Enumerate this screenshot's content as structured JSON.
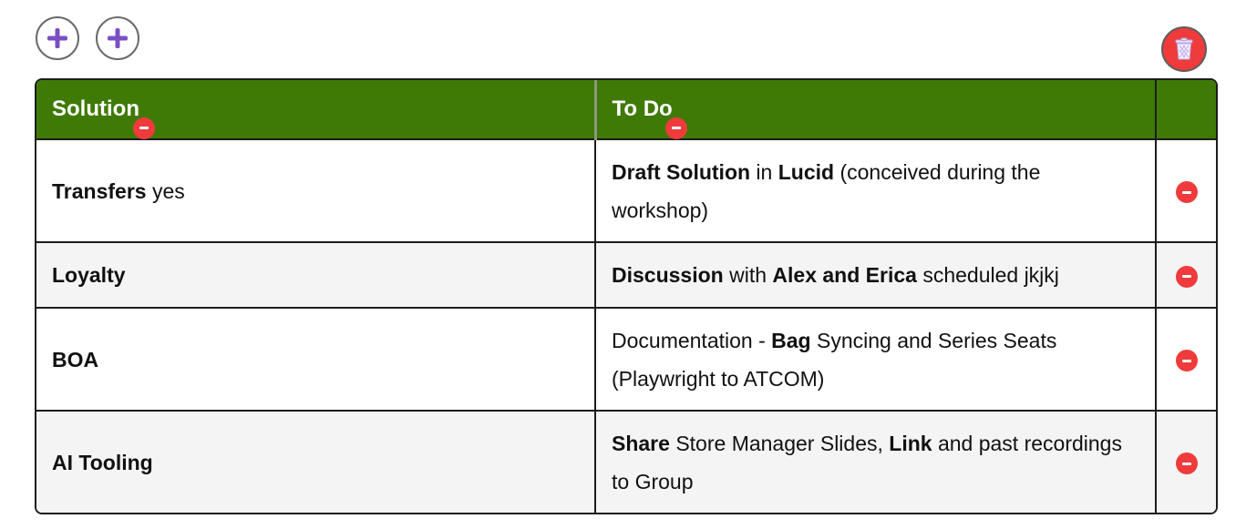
{
  "toolbar": {
    "add_buttons": [
      "add-row",
      "add-column"
    ],
    "delete_icon": "trash-icon"
  },
  "table": {
    "columns": [
      {
        "label": "Solution"
      },
      {
        "label": "To Do"
      }
    ],
    "rows": [
      {
        "solution": [
          {
            "t": "Transfers",
            "b": true
          },
          {
            "t": " yes",
            "b": false
          }
        ],
        "todo": [
          {
            "t": "Draft Solution",
            "b": true
          },
          {
            "t": " in ",
            "b": false
          },
          {
            "t": "Lucid",
            "b": true
          },
          {
            "t": " (conceived during the workshop)",
            "b": false
          }
        ]
      },
      {
        "solution": [
          {
            "t": "Loyalty",
            "b": true
          }
        ],
        "todo": [
          {
            "t": "Discussion",
            "b": true
          },
          {
            "t": " with ",
            "b": false
          },
          {
            "t": "Alex and Erica",
            "b": true
          },
          {
            "t": " scheduled jkjkj",
            "b": false
          }
        ]
      },
      {
        "solution": [
          {
            "t": "BOA",
            "b": true
          }
        ],
        "todo": [
          {
            "t": "Documentation - ",
            "b": false
          },
          {
            "t": "Bag",
            "b": true
          },
          {
            "t": " Syncing and Series Seats (Playwright to ATCOM)",
            "b": false
          }
        ]
      },
      {
        "solution": [
          {
            "t": "AI Tooling",
            "b": true
          }
        ],
        "todo": [
          {
            "t": "Share",
            "b": true
          },
          {
            "t": " Store Manager Slides, ",
            "b": false
          },
          {
            "t": "Link",
            "b": true
          },
          {
            "t": " and past recordings to Group",
            "b": false
          }
        ]
      }
    ]
  },
  "colors": {
    "header_bg": "#3f7a06",
    "remove_red": "#ef3b3b",
    "add_purple": "#7a4fc2",
    "alt_row_bg": "#f4f4f4"
  }
}
